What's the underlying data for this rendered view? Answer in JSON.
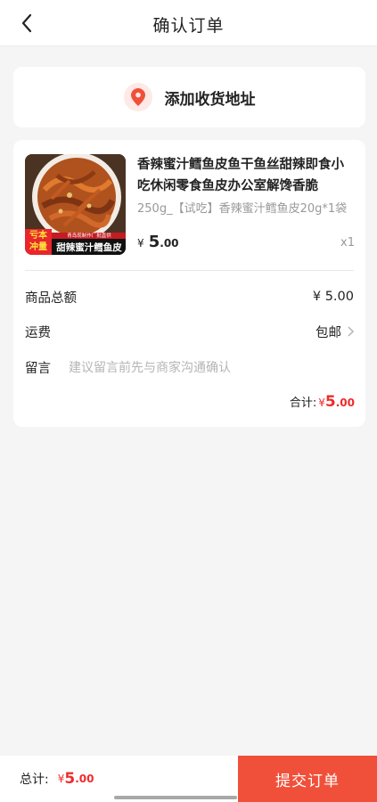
{
  "header": {
    "title": "确认订单",
    "back_icon": "chevron-left-icon"
  },
  "address": {
    "icon": "location-pin-icon",
    "label": "添加收货地址",
    "accent": "#f0503a"
  },
  "product": {
    "title": "香辣蜜汁鳕鱼皮鱼干鱼丝甜辣即食小吃休闲零食鱼皮办公室解馋香脆",
    "spec": "250g_【试吃】香辣蜜汁鳕鱼皮20g*1袋",
    "price_symbol": "¥",
    "price_int": "5",
    "price_dec": ".00",
    "qty": "x1",
    "image": {
      "badge_text_line1": "亏本",
      "badge_text_line2": "冲量",
      "banner_small": "青岛现制作厂批直供",
      "banner_main": "甜辣蜜汁鳕鱼皮"
    }
  },
  "summary": {
    "goods_total_label": "商品总额",
    "goods_total_value": "¥ 5.00",
    "shipping_label": "运费",
    "shipping_value": "包邮",
    "message_label": "留言",
    "message_placeholder": "建议留言前先与商家沟通确认",
    "subtotal_label": "合计:",
    "subtotal_symbol": "¥",
    "subtotal_int": "5",
    "subtotal_dec": ".00"
  },
  "bottom": {
    "total_label": "总计:",
    "total_symbol": "¥",
    "total_int": "5",
    "total_dec": ".00",
    "submit_label": "提交订单"
  },
  "colors": {
    "price_red": "#f02b2b",
    "button": "#f0503a",
    "background": "#f5f5f5"
  }
}
